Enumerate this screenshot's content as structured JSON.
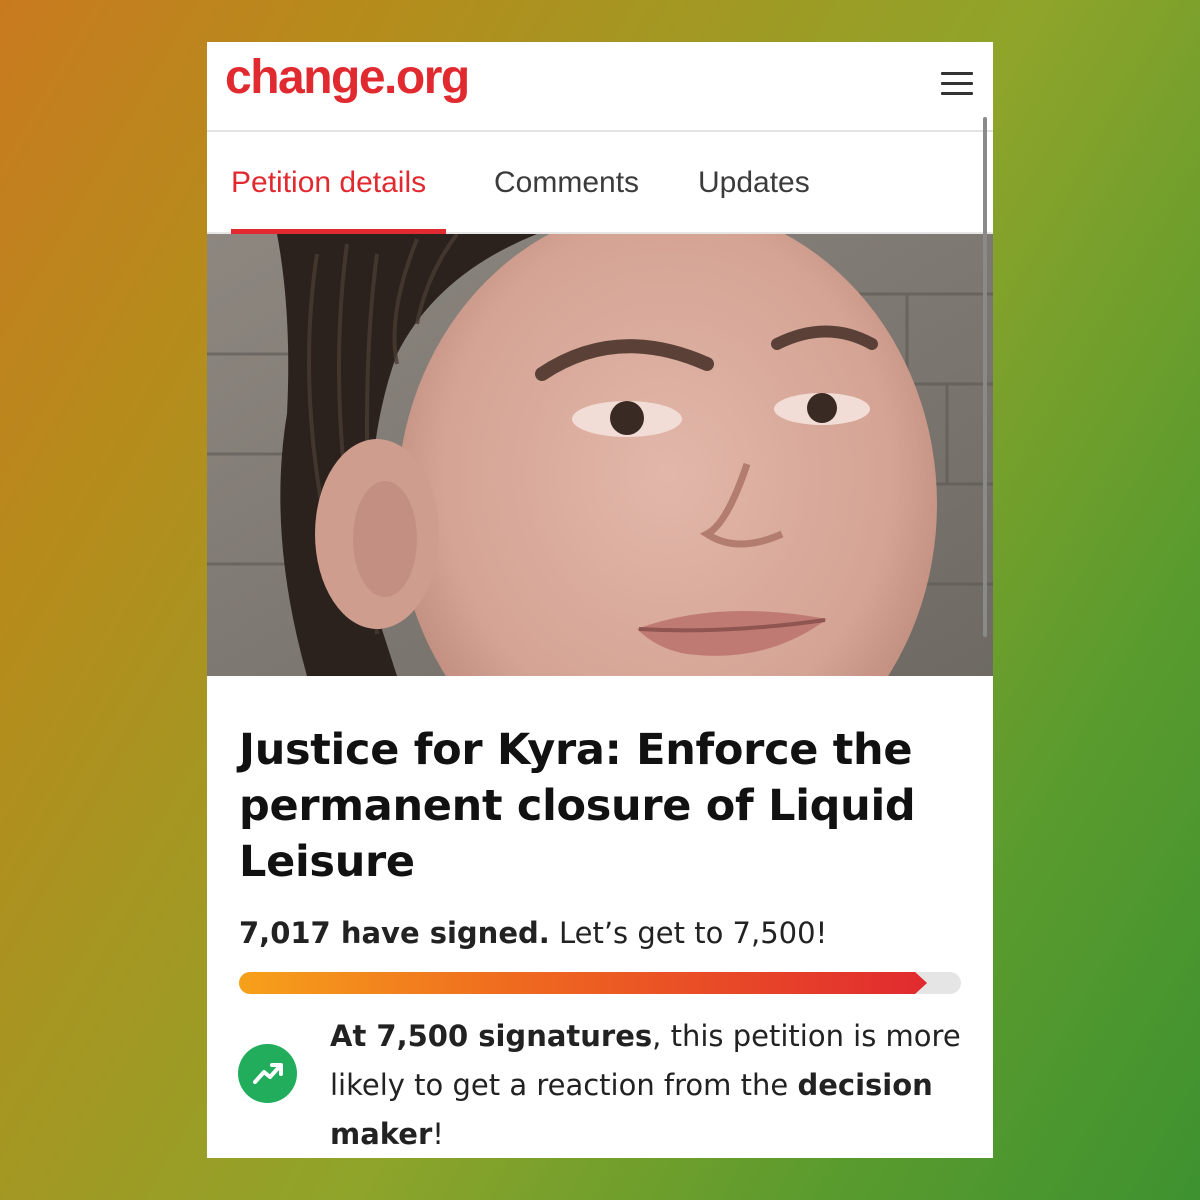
{
  "header": {
    "logo": "change.org",
    "menu_icon": "hamburger-menu-icon"
  },
  "tabs": [
    {
      "label": "Petition details",
      "active": true
    },
    {
      "label": "Comments",
      "active": false
    },
    {
      "label": "Updates",
      "active": false
    }
  ],
  "petition": {
    "title": "Justice for Kyra: Enforce the permanent closure of Liquid Leisure",
    "signed_count": "7,017 have signed.",
    "goal_text": " Let’s get to 7,500!",
    "progress_fraction": 0.953,
    "milestone": {
      "icon": "trending-up-icon",
      "part1_bold": "At 7,500 signatures",
      "part2": ", this petition is more likely to get a reaction from the ",
      "part3_bold": "decision maker",
      "part4": "!"
    }
  },
  "colors": {
    "brand_red": "#e12a2f",
    "trend_green": "#21ad5b",
    "progress_start": "#f6a11a"
  }
}
